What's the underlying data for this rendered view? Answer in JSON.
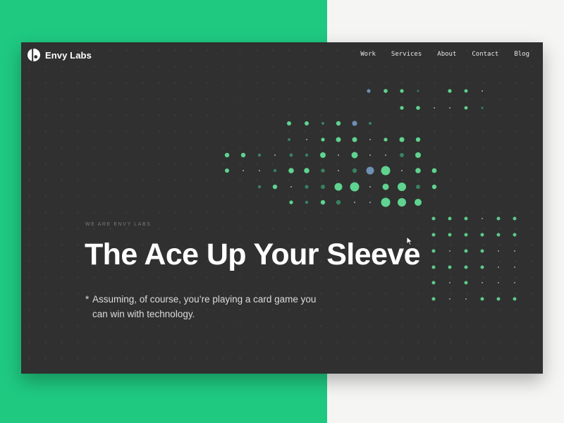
{
  "colors": {
    "brand_green": "#1fc980",
    "window_bg": "#303030",
    "dot_green": "#5fd38f",
    "dot_dim": "#3b8f6a",
    "dot_blue": "#6f8fb5"
  },
  "logo": {
    "text": "Envy Labs",
    "icon": "envy-labs-logo-icon"
  },
  "nav": {
    "items": [
      "Work",
      "Services",
      "About",
      "Contact",
      "Blog"
    ]
  },
  "hero": {
    "eyebrow": "WE ARE ENVY LABS",
    "headline": "The Ace Up Your Sleeve",
    "asterisk": "*",
    "subtext": "Assuming, of course, you’re playing a card game you can win with technology."
  },
  "cursor": {
    "icon": "pointer-cursor-icon"
  }
}
